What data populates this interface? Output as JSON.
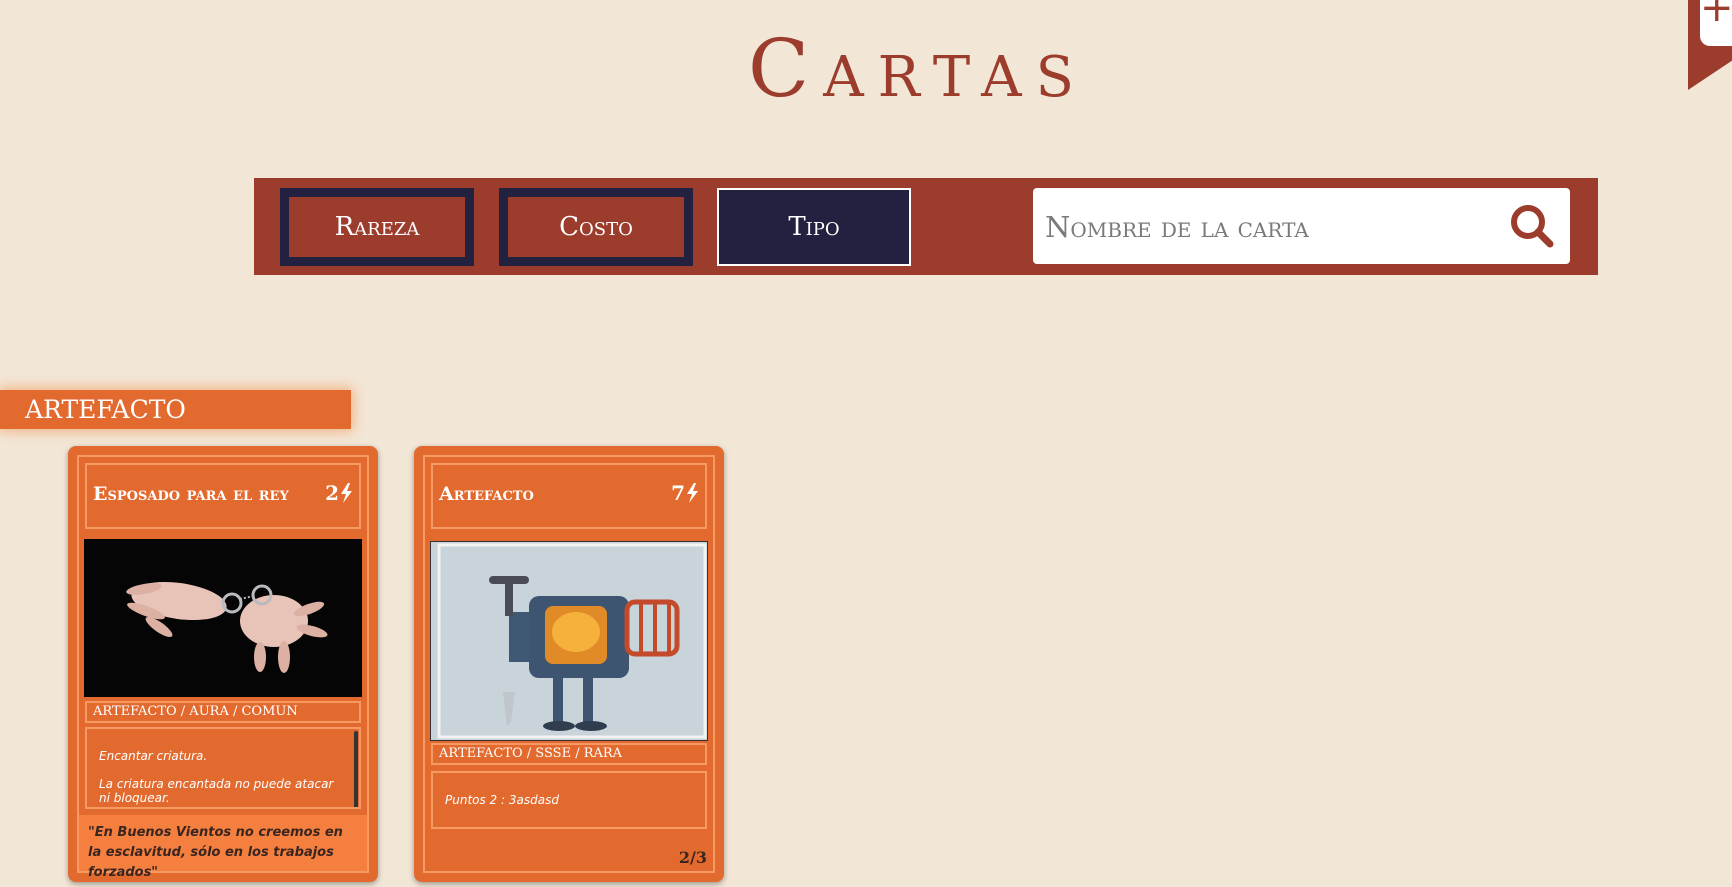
{
  "page": {
    "title": "Cartas"
  },
  "corner": {
    "icon": "plus-icon",
    "symbol": "+"
  },
  "filters": {
    "buttons": [
      {
        "label": "Rareza",
        "active": false
      },
      {
        "label": "Costo",
        "active": false
      },
      {
        "label": "Tipo",
        "active": true
      }
    ],
    "search": {
      "placeholder": "Nombre de la carta",
      "value": "",
      "icon": "search-icon"
    }
  },
  "section": {
    "title": "ARTEFACTO"
  },
  "cards": [
    {
      "name": "Esposado para el rey",
      "cost": "2",
      "cost_icon": "lightning-bolt-icon",
      "image": "handcuffed-hands-image",
      "type_line": "ARTEFACTO / AURA / COMUN",
      "text": [
        "Encantar criatura.",
        "La criatura encantada no puede atacar ni bloquear."
      ],
      "flavor": "\"En Buenos Vientos no creemos en la esclavitud, sólo en los trabajos forzados\""
    },
    {
      "name": "Artefacto",
      "cost": "7",
      "cost_icon": "lightning-bolt-icon",
      "image": "furnace-robot-image",
      "type_line": "ARTEFACTO / SSSE / RARA",
      "text": [
        "Puntos 2 : 3asdasd"
      ],
      "page": "2/3"
    }
  ],
  "colors": {
    "background": "#f2e6d6",
    "primary": "#9c3c2c",
    "navy": "#232140",
    "card": "#e36a2e"
  }
}
